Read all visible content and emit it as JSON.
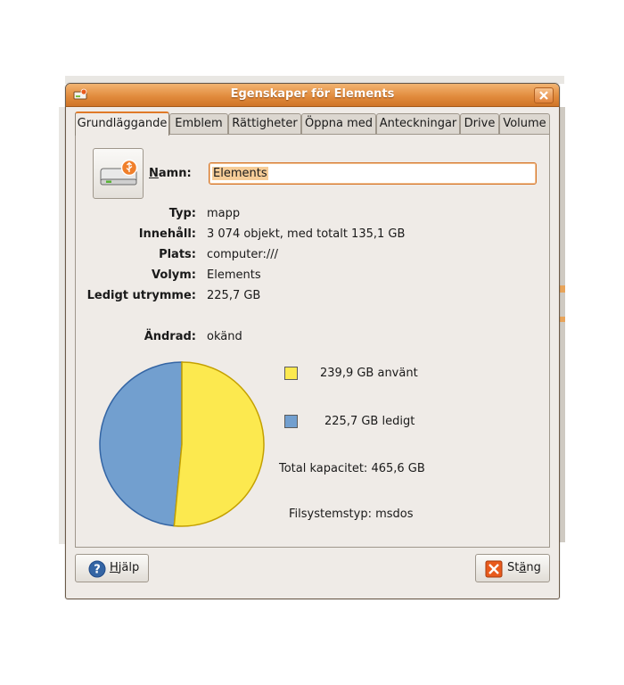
{
  "window": {
    "title": "Egenskaper för Elements"
  },
  "tabs": [
    {
      "label": "Grundläggande",
      "active": true
    },
    {
      "label": "Emblem",
      "active": false
    },
    {
      "label": "Rättigheter",
      "active": false
    },
    {
      "label": "Öppna med",
      "active": false
    },
    {
      "label": "Anteckningar",
      "active": false
    },
    {
      "label": "Drive",
      "active": false
    },
    {
      "label": "Volume",
      "active": false
    }
  ],
  "name": {
    "label_mnemonic": "N",
    "label_rest": "amn:",
    "value": "Elements"
  },
  "info": [
    {
      "label": "Typ:",
      "value": "mapp"
    },
    {
      "label": "Innehåll:",
      "value": "3 074 objekt, med totalt 135,1 GB"
    },
    {
      "label": "Plats:",
      "value": "computer:///"
    },
    {
      "label": "Volym:",
      "value": "Elements"
    },
    {
      "label": "Ledigt utrymme:",
      "value": "225,7 GB"
    }
  ],
  "modified": {
    "label": "Ändrad:",
    "value": "okänd"
  },
  "usage": {
    "used_label": "239,9 GB använt",
    "free_label": "225,7 GB ledigt",
    "total_label": "Total kapacitet: 465,6 GB",
    "fs_label": "Filsystemstyp: msdos",
    "used_fraction": 0.515,
    "used_color": "#fce94f",
    "free_color": "#729fcf"
  },
  "buttons": {
    "help": {
      "mnemonic": "H",
      "rest": "jälp"
    },
    "close": {
      "pre": "St",
      "mnemonic": "ä",
      "rest": "ng"
    }
  },
  "icons": {
    "drive": "removable-drive-icon",
    "help": "help-icon",
    "close": "close-icon",
    "window_close": "window-close-icon"
  }
}
